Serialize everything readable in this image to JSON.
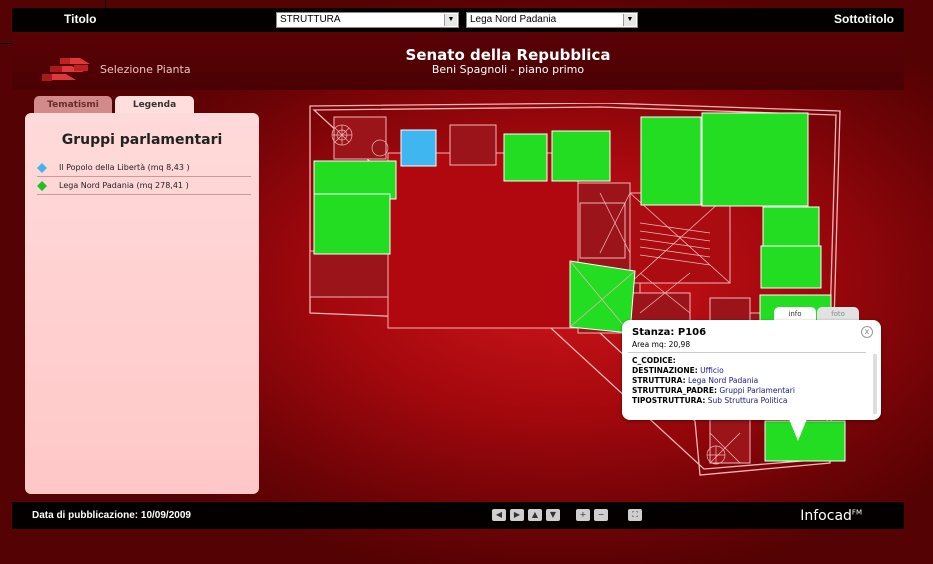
{
  "topbar": {
    "title": "Titolo",
    "subtitle": "Sottotitolo",
    "select_struttura": "STRUTTURA",
    "select_group": "Lega Nord Padania"
  },
  "header": {
    "logo_label": "Selezione Pianta",
    "title": "Senato della Repubblica",
    "subtitle": "Beni Spagnoli - piano primo"
  },
  "tabs": [
    {
      "label": "Tematismi"
    },
    {
      "label": "Legenda"
    }
  ],
  "legend": {
    "title": "Gruppi parlamentari",
    "items": [
      {
        "label": "Il Popolo della Libertà (mq 8,43 )",
        "color": "#3fb6f0"
      },
      {
        "label": "Lega Nord Padania (mq 278,41 )",
        "color": "#20c020"
      }
    ]
  },
  "popup": {
    "tab_info": "info",
    "tab_foto": "foto",
    "close": "x",
    "stanza": "Stanza: P106",
    "area": "Area mq: 20,98",
    "rows": [
      {
        "key": "C_CODICE:",
        "value": ""
      },
      {
        "key": "DESTINAZIONE:",
        "value": "Ufficio"
      },
      {
        "key": "STRUTTURA:",
        "value": "Lega Nord Padania"
      },
      {
        "key": "STRUTTURA_PADRE:",
        "value": "Gruppi Parlamentari"
      },
      {
        "key": "TIPOSTRUTTURA:",
        "value": "Sub Struttura Politica"
      }
    ]
  },
  "footer": {
    "pubdate": "Data di pubblicazione: 10/09/2009",
    "brand": "Infocad",
    "brand_sup": "FM",
    "nav": [
      {
        "name": "pan-left-button",
        "glyph": "◀"
      },
      {
        "name": "pan-right-button",
        "glyph": "▶"
      },
      {
        "name": "pan-up-button",
        "glyph": "▲"
      },
      {
        "name": "pan-down-button",
        "glyph": "▼"
      },
      {
        "name": "zoom-in-button",
        "glyph": "+"
      },
      {
        "name": "zoom-out-button",
        "glyph": "−"
      },
      {
        "name": "zoom-fit-button",
        "glyph": "⛶"
      }
    ]
  },
  "colors": {
    "room_green": "#22dd22",
    "room_blue": "#3fb6f0",
    "room_red": "#b0080e"
  }
}
